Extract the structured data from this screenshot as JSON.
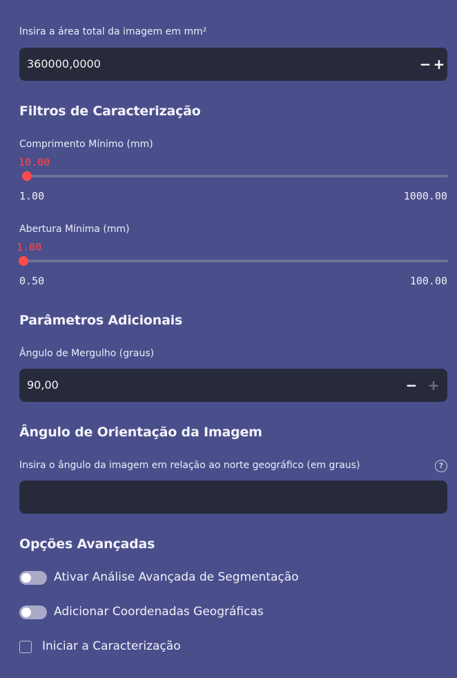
{
  "area_input": {
    "label": "Insira a área total da imagem em mm²",
    "value": "360000,0000",
    "minus": "−",
    "plus": "+"
  },
  "filters": {
    "heading": "Filtros de Caracterização",
    "length_slider": {
      "label": "Comprimento Mínimo (mm)",
      "value": "10.00",
      "min": "1.00",
      "max": "1000.00",
      "fraction": 0.009
    },
    "aperture_slider": {
      "label": "Abertura Mínima (mm)",
      "value": "1.00",
      "min": "0.50",
      "max": "100.00",
      "fraction": 0.005
    }
  },
  "additional": {
    "heading": "Parâmetros Adicionais",
    "dip_input": {
      "label": "Ângulo de Mergulho (graus)",
      "value": "90,00",
      "minus": "−",
      "plus": "+"
    }
  },
  "orientation": {
    "heading": "Ângulo de Orientação da Imagem",
    "input_label": "Insira o ângulo da imagem em relação ao norte geográfico (em graus)",
    "value": "",
    "help_glyph": "?"
  },
  "advanced": {
    "heading": "Opções Avançadas",
    "toggle_segmentation": {
      "label": "Ativar Análise Avançada de Segmentação",
      "checked": false
    },
    "toggle_coordinates": {
      "label": "Adicionar Coordenadas Geográficas",
      "checked": false
    },
    "checkbox_start": {
      "label": "Iniciar a Caracterização",
      "checked": false
    }
  },
  "colors": {
    "background": "#4a4e8b",
    "input_bg": "#272a3a",
    "accent": "#ff4b4b"
  }
}
